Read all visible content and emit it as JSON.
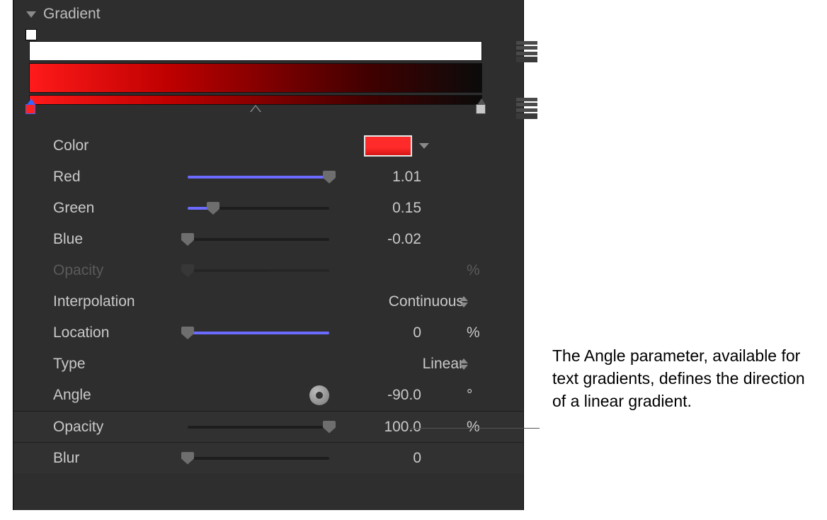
{
  "header": {
    "title": "Gradient"
  },
  "params": {
    "color_label": "Color",
    "red": {
      "label": "Red",
      "value": "1.01",
      "fill": 100
    },
    "green": {
      "label": "Green",
      "value": "0.15",
      "fill": 18
    },
    "blue": {
      "label": "Blue",
      "value": "-0.02",
      "fill": 0
    },
    "opacity_inner": {
      "label": "Opacity",
      "unit": "%"
    },
    "interpolation": {
      "label": "Interpolation",
      "value": "Continuous"
    },
    "location": {
      "label": "Location",
      "value": "0",
      "unit": "%",
      "fill": 0
    },
    "type": {
      "label": "Type",
      "value": "Linear"
    },
    "angle": {
      "label": "Angle",
      "value": "-90.0",
      "unit": "°"
    },
    "opacity": {
      "label": "Opacity",
      "value": "100.0",
      "unit": "%",
      "fill": 100
    },
    "blur": {
      "label": "Blur",
      "value": "0",
      "fill": 0
    }
  },
  "annotation": "The Angle parameter, available for text gradients, defines the direction of a linear gradient.",
  "colors": {
    "selected_stop": "#ff2020"
  }
}
